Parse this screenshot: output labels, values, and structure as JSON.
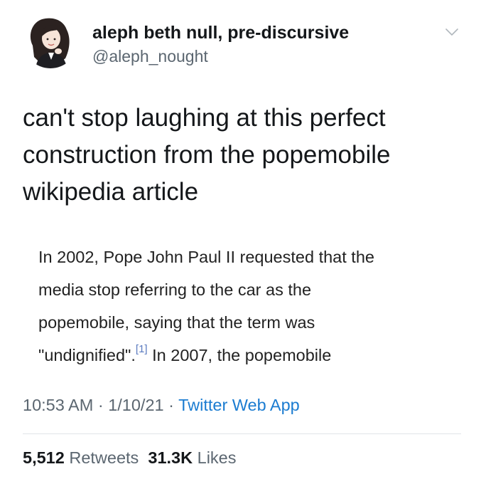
{
  "user": {
    "display_name": "aleph beth null, pre-discursive",
    "handle": "@aleph_nought",
    "avatar_icon": "avatar-illustration"
  },
  "menu_icon": "chevron-down-icon",
  "tweet": {
    "text_lines": [
      "can't stop laughing at this perfect",
      "construction from the popemobile",
      "wikipedia article"
    ]
  },
  "quote": {
    "line1": "In 2002, Pope John Paul II requested that the",
    "line2": "media stop referring to the car as the",
    "line3": "popemobile, saying that the term was",
    "line4_before": "\"undignified\".",
    "line4_ref": "[1]",
    "line4_after": " In 2007, the popemobile",
    "ref_color": "#5b7bc0"
  },
  "meta": {
    "time": "10:53 AM",
    "separator": "·",
    "date": "1/10/21",
    "source": "Twitter Web App"
  },
  "stats": {
    "retweets_count": "5,512",
    "retweets_label": "Retweets",
    "likes_count": "31.3K",
    "likes_label": "Likes"
  },
  "colors": {
    "text": "#14171a",
    "secondary": "#5b6670",
    "link": "#1b7cd1",
    "divider": "#e1e4e8"
  }
}
